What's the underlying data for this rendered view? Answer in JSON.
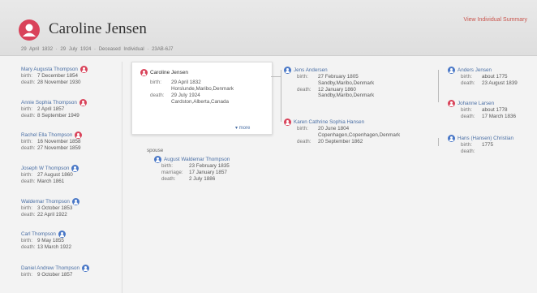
{
  "person": {
    "name": "Caroline Jensen",
    "meta": "29 April 1832 · 29 July 1924 · Deceased Individual · 23AB-6J7",
    "summary_link": "View Individual Summary"
  },
  "children": [
    {
      "name": "Mary Augusta Thompson",
      "gender": "female",
      "birth_label": "birth:",
      "birth": "7 December 1854",
      "death_label": "death:",
      "death": "28 November 1930"
    },
    {
      "name": "Annie Sophia Thompson",
      "gender": "female",
      "birth_label": "birth:",
      "birth": "2 April 1857",
      "death_label": "death:",
      "death": "8 September 1949"
    },
    {
      "name": "Rachel Ella Thompson",
      "gender": "female",
      "birth_label": "birth:",
      "birth": "16 November 1858",
      "death_label": "death:",
      "death": "27 November 1859"
    },
    {
      "name": "Joseph W Thompson",
      "gender": "male",
      "birth_label": "birth:",
      "birth": "27 August 1860",
      "death_label": "death:",
      "death": "March 1861"
    },
    {
      "name": "Waldemar Thompson",
      "gender": "male",
      "birth_label": "birth:",
      "birth": "3 October 1853",
      "death_label": "death:",
      "death": "22 April 1922"
    },
    {
      "name": "Carl Thompson",
      "gender": "male",
      "birth_label": "birth:",
      "birth": "9 May 1855",
      "death_label": "death:",
      "death": "13 March 1922"
    },
    {
      "name": "Daniel Andrew Thompson",
      "gender": "male",
      "birth_label": "birth:",
      "birth": "9 October 1857",
      "death_label": "",
      "death": ""
    }
  ],
  "focus": {
    "name": "Caroline Jensen",
    "birth_label": "birth:",
    "birth_date": "29 April 1832",
    "birth_place": "Horslunde,Maribo,Denmark",
    "death_label": "death:",
    "death_date": "29 July 1924",
    "death_place": "Cardston,Alberta,Canada",
    "more": "▾ more"
  },
  "spouse": {
    "label": "spouse",
    "name": "August Waldemar Thompson",
    "birth_label": "birth:",
    "birth": "23 February 1835",
    "marriage_label": "marriage:",
    "marriage": "17 January 1857",
    "death_label": "death:",
    "death": "2 July 1886"
  },
  "father": {
    "name": "Jens Andersen",
    "birth_label": "birth:",
    "birth_date": "27 February 1805",
    "birth_place": "Sandby,Maribo,Denmark",
    "death_label": "death:",
    "death_date": "12 January 1860",
    "death_place": "Sandby,Maribo,Denmark"
  },
  "mother": {
    "name": "Karen Cathrine Sophia Hansen",
    "birth_label": "birth:",
    "birth_date": "20 June 1804",
    "birth_place": "Copenhagen,Copenhagen,Denmark",
    "death_label": "death:",
    "death_date": "20 September 1862"
  },
  "gf_paternal": {
    "name": "Anders Jensen",
    "birth_label": "birth:",
    "birth": "about 1775",
    "death_label": "death:",
    "death": "23 August 1839"
  },
  "gm_paternal": {
    "name": "Johanne Larsen",
    "birth_label": "birth:",
    "birth": "about 1778",
    "death_label": "death:",
    "death": "17 March 1836"
  },
  "gf_maternal": {
    "name": "Hans (Hansen) Christian",
    "birth_label": "birth:",
    "birth": "1775",
    "death_label": "death:",
    "death": ""
  },
  "colors": {
    "female": "#d9435a",
    "male": "#4a78c7",
    "link": "#4a6fa5",
    "accent": "#c9544c"
  }
}
